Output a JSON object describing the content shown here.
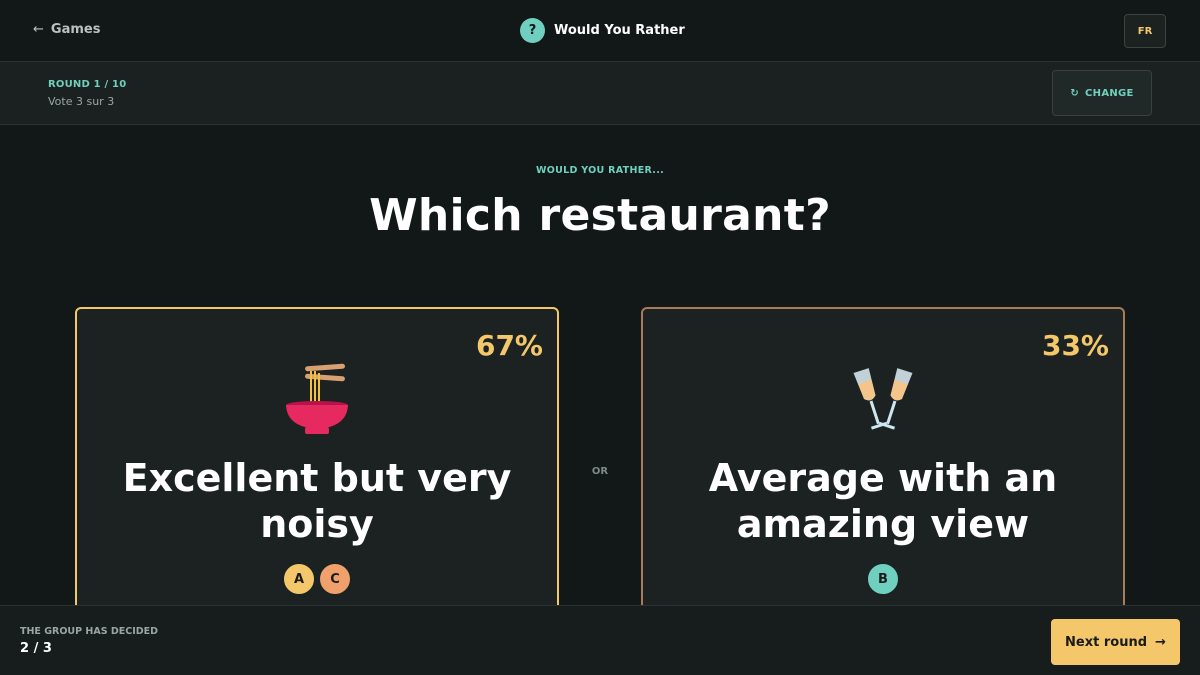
{
  "header": {
    "back_arrow": "←",
    "back_label": "Games",
    "title_icon": "?",
    "title": "Would You Rather",
    "lang": "FR"
  },
  "round": {
    "label": "ROUND 1 / 10",
    "vote_status": "Vote 3 sur 3",
    "change_icon": "↻",
    "change_label": "CHANGE"
  },
  "question": {
    "kicker": "WOULD YOU RATHER...",
    "title": "Which restaurant?"
  },
  "options": [
    {
      "percent": "67%",
      "text": "Excellent but very noisy",
      "icon": "noodle-bowl-icon",
      "border_color": "#f4c86a",
      "voters": [
        {
          "initial": "A",
          "color": "#f4c86a"
        },
        {
          "initial": "C",
          "color": "#f0a06a"
        }
      ]
    },
    {
      "percent": "33%",
      "text": "Average with an amazing view",
      "icon": "clinking-glasses-icon",
      "border_color": "#a77b5c",
      "voters": [
        {
          "initial": "B",
          "color": "#6fd0bf"
        }
      ]
    }
  ],
  "or_label": "OR",
  "footer": {
    "decided_label": "THE GROUP HAS DECIDED",
    "decided_count": "2 / 3",
    "next_label": "Next round",
    "next_arrow": "→"
  },
  "colors": {
    "background": "#121817",
    "accent_teal": "#6fd0bf",
    "accent_gold": "#f4c86a"
  }
}
